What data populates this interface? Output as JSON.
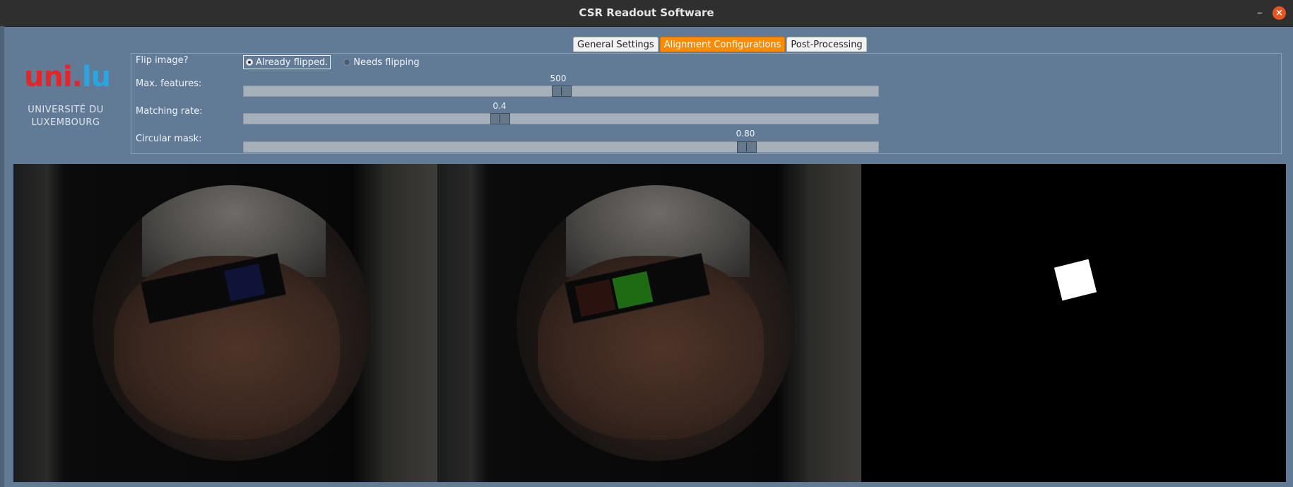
{
  "window": {
    "title": "CSR Readout Software",
    "minimize_icon": "minimize-icon",
    "close_icon": "close-icon",
    "minimize_glyph": "–",
    "close_glyph": "×"
  },
  "tabs": [
    {
      "label": "General Settings",
      "active": false
    },
    {
      "label": "Alignment Configurations",
      "active": true
    },
    {
      "label": "Post-Processing",
      "active": false
    }
  ],
  "logo": {
    "red_part": "uni.",
    "blue_part": "lu",
    "line1": "UNIVERSITÉ DU",
    "line2": "LUXEMBOURG"
  },
  "settings": {
    "flip": {
      "label": "Flip image?",
      "options": [
        {
          "label": "Already flipped.",
          "selected": true
        },
        {
          "label": "Needs flipping",
          "selected": false
        }
      ]
    },
    "max_features": {
      "label": "Max. features:",
      "value": "500",
      "fraction": 0.5
    },
    "matching_rate": {
      "label": "Matching rate:",
      "value": "0.4",
      "fraction": 0.4
    },
    "circular_mask": {
      "label": "Circular mask:",
      "value": "0.80",
      "fraction": 0.8
    }
  },
  "colors": {
    "background": "#617a96",
    "active_tab": "#ff8c00",
    "close_button": "#e95420",
    "logo_red": "#e3262c",
    "logo_blue": "#29a6de"
  }
}
